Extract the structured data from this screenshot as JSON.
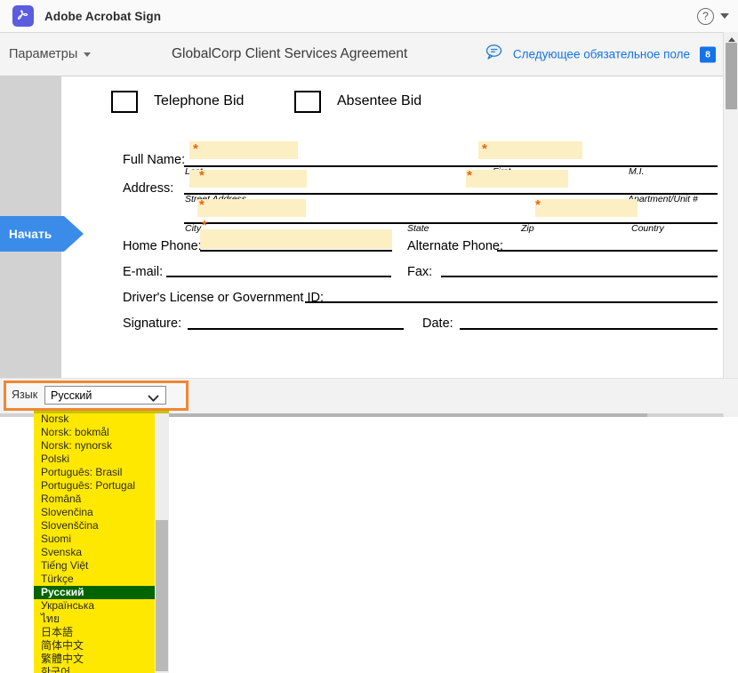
{
  "brand": {
    "logo_icon": "acrobat-logo-icon",
    "title": "Adobe Acrobat Sign",
    "help_icon": "help-question-icon",
    "help_label": "?",
    "dropdown_icon": "chevron-down-icon"
  },
  "toolbar": {
    "params_label": "Параметры",
    "params_caret_icon": "chevron-down-icon",
    "document_title": "GlobalCorp Client Services Agreement",
    "comment_icon": "comment-bubble-icon",
    "next_field_label": "Следующее обязательное поле",
    "field_count_badge": "8"
  },
  "start_tab": {
    "label": "Начать"
  },
  "form": {
    "checkboxes": [
      {
        "label": "Telephone Bid"
      },
      {
        "label": "Absentee Bid"
      }
    ],
    "rows": [
      {
        "label": "Full Name:"
      },
      {
        "label": "Address:"
      },
      {
        "label": "Home Phone:"
      },
      {
        "label": "Alternate Phone:"
      },
      {
        "label": "E-mail:"
      },
      {
        "label": "Fax:"
      },
      {
        "label": "Driver's License or Government ID:"
      },
      {
        "label": "Signature:"
      },
      {
        "label": "Date:"
      }
    ],
    "sublabels": [
      {
        "text": "Last"
      },
      {
        "text": "First"
      },
      {
        "text": "M.I."
      },
      {
        "text": "Street Address"
      },
      {
        "text": "Apartment/Unit #"
      },
      {
        "text": "City"
      },
      {
        "text": "State"
      },
      {
        "text": "Zip"
      },
      {
        "text": "Country"
      }
    ],
    "required_marker": "*"
  },
  "language_bar": {
    "label": "Язык",
    "selected": "Русский",
    "chevron_icon": "chevron-down-icon"
  },
  "language_options": [
    {
      "label": "Norsk",
      "selected": false
    },
    {
      "label": "Norsk: bokmål",
      "selected": false
    },
    {
      "label": "Norsk: nynorsk",
      "selected": false
    },
    {
      "label": "Polski",
      "selected": false
    },
    {
      "label": "Português: Brasil",
      "selected": false
    },
    {
      "label": "Português: Portugal",
      "selected": false
    },
    {
      "label": "Română",
      "selected": false
    },
    {
      "label": "Slovenčina",
      "selected": false
    },
    {
      "label": "Slovenščina",
      "selected": false
    },
    {
      "label": "Suomi",
      "selected": false
    },
    {
      "label": "Svenska",
      "selected": false
    },
    {
      "label": "Tiếng Việt",
      "selected": false
    },
    {
      "label": "Türkçe",
      "selected": false
    },
    {
      "label": "Русский",
      "selected": true
    },
    {
      "label": "Українська",
      "selected": false
    },
    {
      "label": "ไทย",
      "selected": false
    },
    {
      "label": "日本語",
      "selected": false
    },
    {
      "label": "简体中文",
      "selected": false
    },
    {
      "label": "繁體中文",
      "selected": false
    },
    {
      "label": "한국어",
      "selected": false
    }
  ],
  "colors": {
    "accent_blue": "#1473e6",
    "start_blue": "#3b8ce8",
    "required_field": "#fcefc3",
    "required_star": "#e8650d",
    "highlight_orange": "#ef8733",
    "dropdown_yellow": "#ffe800",
    "dropdown_selected": "#006400",
    "logo_purple": "#5C5CE0"
  }
}
